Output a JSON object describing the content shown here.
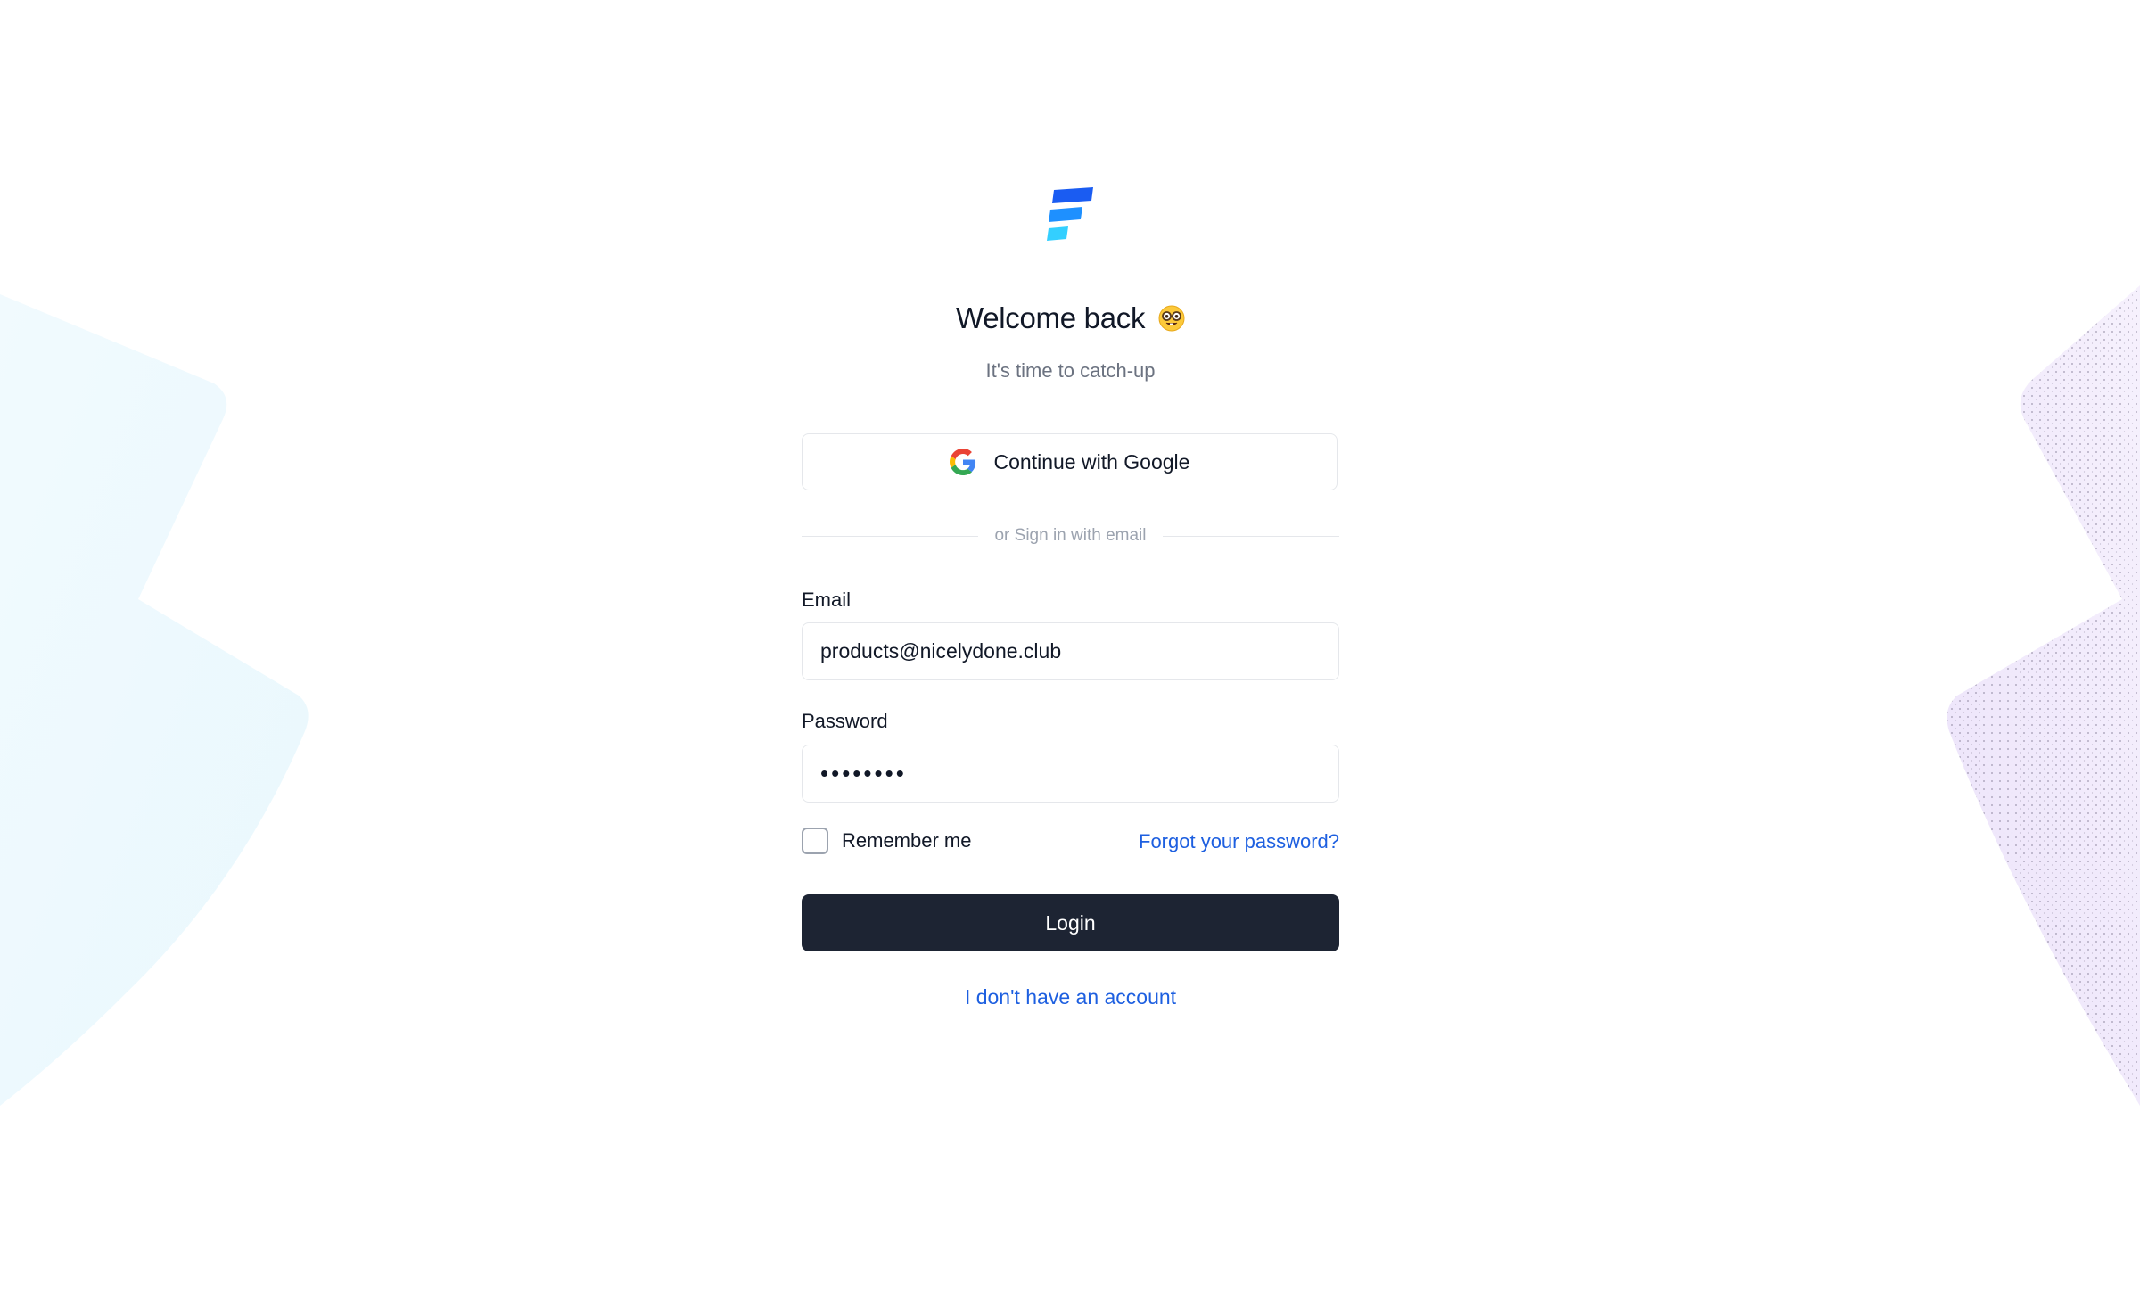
{
  "header": {
    "logo_icon": "stacked-bars-logo-icon",
    "title": "Welcome back",
    "title_emoji_icon": "nerd-face-emoji-icon",
    "subtitle": "It's time to catch-up"
  },
  "oauth": {
    "google_label": "Continue with Google",
    "google_icon": "google-icon"
  },
  "divider": {
    "text": "or Sign in with email"
  },
  "form": {
    "email_label": "Email",
    "email_value": "products@nicelydone.club",
    "password_label": "Password",
    "password_value": "••••••••",
    "remember_label": "Remember me",
    "remember_checked": false,
    "forgot_label": "Forgot your password?",
    "login_label": "Login"
  },
  "footer": {
    "signup_label": "I don't have an account"
  },
  "colors": {
    "primary_button": "#1d2433",
    "link": "#1d5fe0",
    "logo_top": "#1a5cf2",
    "logo_mid": "#1e90ff",
    "logo_bottom": "#33cfff",
    "muted_text": "#6b7280",
    "border": "#e5e7eb"
  }
}
